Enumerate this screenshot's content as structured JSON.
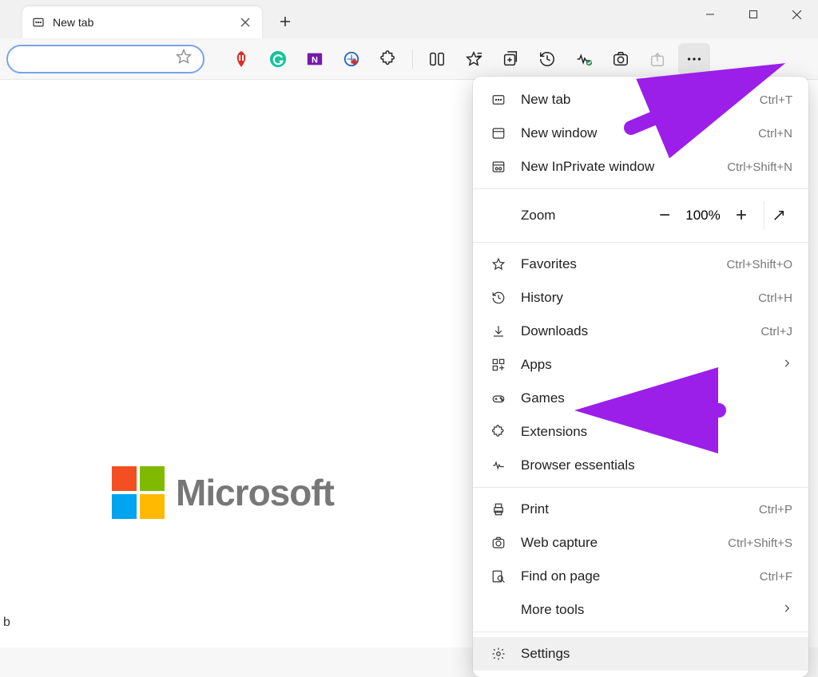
{
  "tab": {
    "title": "New tab"
  },
  "bottom_label": "b",
  "logo_text": "Microsoft",
  "menu": {
    "new_tab": {
      "label": "New tab",
      "shortcut": "Ctrl+T"
    },
    "new_window": {
      "label": "New window",
      "shortcut": "Ctrl+N"
    },
    "new_inprivate": {
      "label": "New InPrivate window",
      "shortcut": "Ctrl+Shift+N"
    },
    "zoom": {
      "label": "Zoom",
      "value": "100%"
    },
    "favorites": {
      "label": "Favorites",
      "shortcut": "Ctrl+Shift+O"
    },
    "history": {
      "label": "History",
      "shortcut": "Ctrl+H"
    },
    "downloads": {
      "label": "Downloads",
      "shortcut": "Ctrl+J"
    },
    "apps": {
      "label": "Apps"
    },
    "games": {
      "label": "Games"
    },
    "extensions": {
      "label": "Extensions"
    },
    "browser_essentials": {
      "label": "Browser essentials"
    },
    "print": {
      "label": "Print",
      "shortcut": "Ctrl+P"
    },
    "web_capture": {
      "label": "Web capture",
      "shortcut": "Ctrl+Shift+S"
    },
    "find": {
      "label": "Find on page",
      "shortcut": "Ctrl+F"
    },
    "more_tools": {
      "label": "More tools"
    },
    "settings": {
      "label": "Settings"
    }
  }
}
